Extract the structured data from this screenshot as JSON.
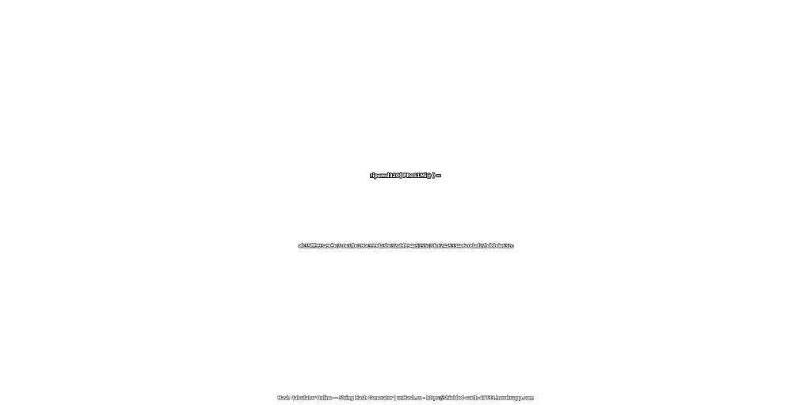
{
  "heading": {
    "expression": "ripemd320( PRoS1Mi@ ) ="
  },
  "result": {
    "hash": "efc35fff993a9d9c7c0e1fbc280c399da3b032ebf894e5155c7dc624a5334e6c0dad27bd8bde632c"
  },
  "footer": {
    "text": "Hash Calculator Online — String Hash Generator | unHash.co - https://shielded-earth-47733.herokuapp.com"
  },
  "colors": {
    "background": "#ffffff",
    "text_fill": "#ffffff",
    "text_outline": "#222222"
  }
}
